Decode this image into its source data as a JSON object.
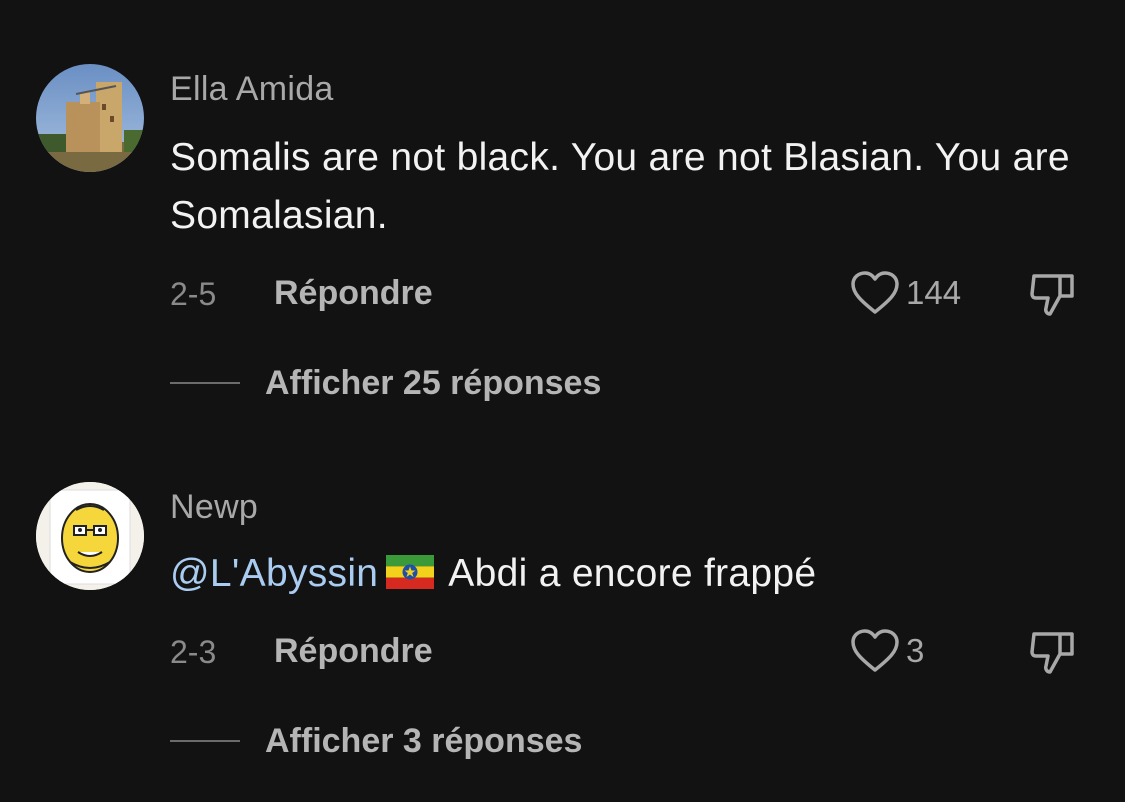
{
  "comments": [
    {
      "username": "Ella Amida",
      "text": "Somalis are not black. You are not Blasian. You are Somalasian.",
      "date": "2-5",
      "reply_label": "Répondre",
      "likes": "144",
      "view_replies": "Afficher 25 réponses",
      "avatar_icon": "building-photo"
    },
    {
      "username": "Newp",
      "mention": "@L'Abyssin",
      "mention_flag": "ethiopia-flag-icon",
      "text": "Abdi a encore frappé",
      "date": "2-3",
      "reply_label": "Répondre",
      "likes": "3",
      "view_replies": "Afficher 3 réponses",
      "avatar_icon": "cartoon-face"
    }
  ],
  "colors": {
    "background": "#121212",
    "text": "#f2f2f2",
    "muted": "#a8a8a8",
    "mention": "#a9ccf0"
  }
}
